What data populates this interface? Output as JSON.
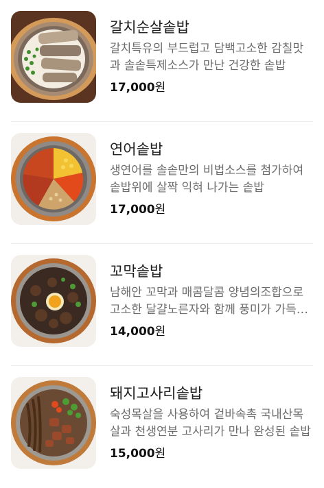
{
  "menu": {
    "items": [
      {
        "name": "갈치순살솥밥",
        "description": "갈치특유의 부드럽고 담백고소한 감칠맛과 솔솥특제소스가 만난 건강한 솥밥",
        "price": "17,000",
        "currency": "원",
        "photo": "cutlassfish-sotbap-photo"
      },
      {
        "name": "연어솥밥",
        "description": "생연어를 솔솥만의 비법소스를 첨가하여 솥밥위에 살짝 익혀 나가는 솥밥",
        "price": "17,000",
        "currency": "원",
        "photo": "salmon-sotbap-photo"
      },
      {
        "name": "꼬막솥밥",
        "description": "남해안 꼬막과 매콤달콤 양념의조합으로 고소한 달걀노른자와 함께 풍미가 가득한 솥밥",
        "price": "14,000",
        "currency": "원",
        "photo": "cockle-sotbap-photo"
      },
      {
        "name": "돼지고사리솥밥",
        "description": "숙성목살을 사용하여 겉바속촉 국내산목살과 천생연분 고사리가 만나 완성된 솥밥",
        "price": "15,000",
        "currency": "원",
        "photo": "pork-fernbrake-sotbap-photo"
      }
    ]
  }
}
